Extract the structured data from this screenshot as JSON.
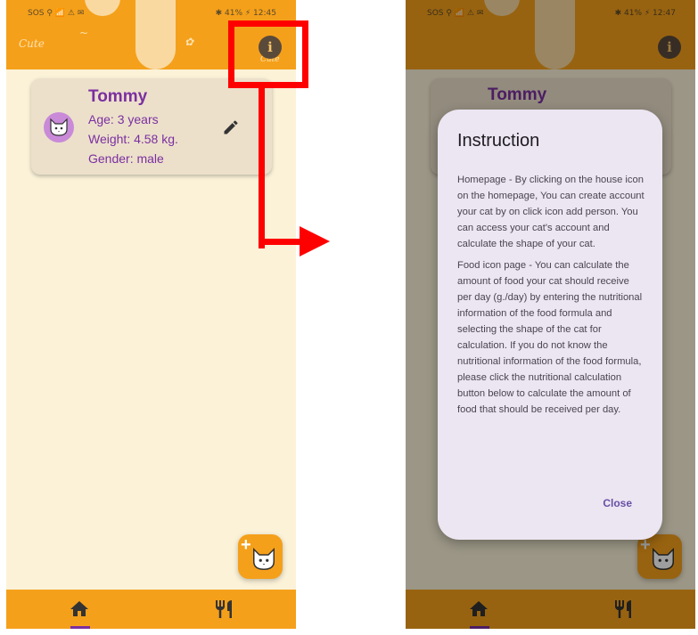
{
  "colors": {
    "brand": "#f5a01a",
    "accent": "#7b2fa0",
    "background": "#fbf2d8",
    "highlight": "#ff0000"
  },
  "left_screen": {
    "status_left": "SOS ⚲ 📶 ⚠ ✉",
    "status_right": "✱ 41% ⚡ 12:45",
    "doodles": [
      "Cute",
      "~",
      "✿",
      "Cute"
    ],
    "info_button_icon": "info-icon",
    "cat": {
      "name": "Tommy",
      "age": "Age: 3 years",
      "weight": "Weight: 4.58 kg.",
      "gender": "Gender: male"
    },
    "fab_icon": "add-cat-icon",
    "nav": [
      {
        "icon": "home-icon",
        "active": true
      },
      {
        "icon": "fork-knife-icon",
        "active": false
      }
    ]
  },
  "right_screen": {
    "status_left": "SOS ⚲ 📶 ⚠ ✉",
    "status_right": "✱ 41% ⚡ 12:47",
    "cat": {
      "name": "Tommy"
    },
    "dialog": {
      "title": "Instruction",
      "paragraph1": "Homepage - By clicking on the house icon on the homepage, You can create account your cat by on click icon add person. You can access your cat's account and calculate the shape of your cat.",
      "paragraph2": "Food icon page - You can calculate the amount of food your cat should receive per day (g./day) by entering the nutritional information of the food formula and selecting the shape of the cat for calculation. If you do not know the nutritional information of the food formula, please click the nutritional calculation button below to calculate the amount of food that should be received per day.",
      "close_label": "Close"
    }
  }
}
